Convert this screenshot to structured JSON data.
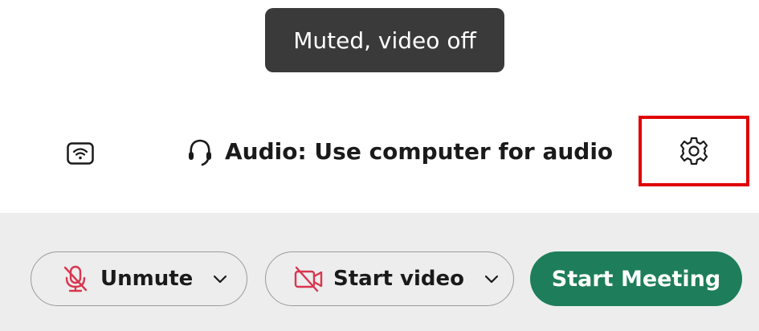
{
  "tooltip": {
    "text": "Muted, video off"
  },
  "info": {
    "connection_icon": "wifi-icon",
    "audio_icon": "headset-icon",
    "audio_label": "Audio: Use computer for audio",
    "settings_icon": "gear-icon"
  },
  "controls": {
    "unmute_label": "Unmute",
    "unmute_icon": "microphone-muted-icon",
    "video_label": "Start video",
    "video_icon": "video-off-icon",
    "start_label": "Start Meeting"
  },
  "colors": {
    "tooltip_bg": "#3a3a3a",
    "highlight_border": "#e00000",
    "muted_icon": "#d9364f",
    "start_button": "#1e7d5a",
    "control_bar_bg": "#ededed"
  }
}
